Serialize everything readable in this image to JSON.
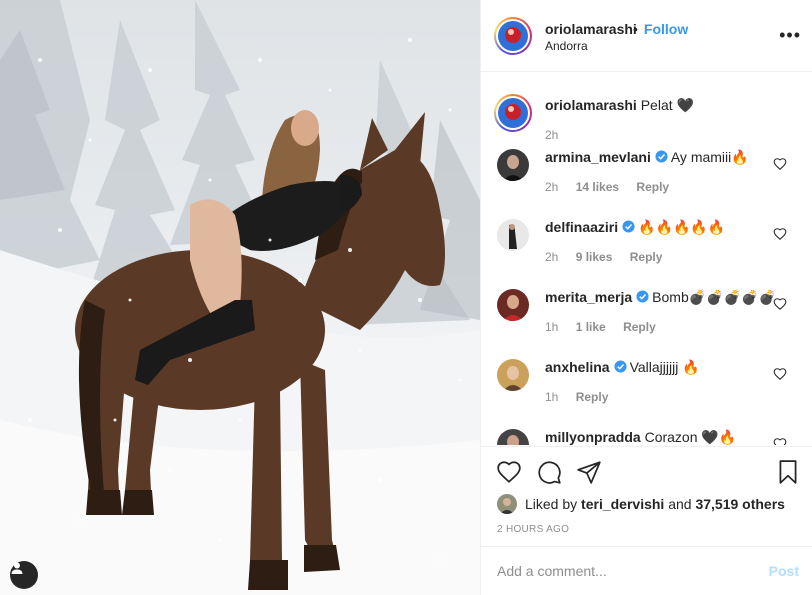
{
  "post": {
    "username": "oriolamarashi",
    "follow_label": "Follow",
    "separator": "•",
    "location": "Andorra",
    "more_label": "•••",
    "caption": {
      "username": "oriolamarashi",
      "text": "Pelat 🖤",
      "time": "2h"
    }
  },
  "comments": [
    {
      "username": "armina_mevlani",
      "verified": true,
      "text": "Ay mamiii🔥",
      "time": "2h",
      "likes": "14 likes",
      "reply": "Reply"
    },
    {
      "username": "delfinaaziri",
      "verified": true,
      "text": "🔥🔥🔥🔥🔥",
      "time": "2h",
      "likes": "9 likes",
      "reply": "Reply"
    },
    {
      "username": "merita_merja",
      "verified": true,
      "text": "Bomb💣💣💣💣💣",
      "time": "1h",
      "likes": "1 like",
      "reply": "Reply"
    },
    {
      "username": "anxhelina",
      "verified": true,
      "text": "Vallajjjjjj 🔥",
      "time": "1h",
      "likes": "",
      "reply": "Reply"
    },
    {
      "username": "millyonpradda",
      "verified": false,
      "text": "Corazon 🖤🔥",
      "time": "",
      "likes": "",
      "reply": ""
    }
  ],
  "likes": {
    "prefix": "Liked by",
    "user": "teri_dervishi",
    "connector": "and",
    "others": "37,519 others"
  },
  "timestamp": "2 HOURS AGO",
  "add_comment": {
    "placeholder": "Add a comment...",
    "post_label": "Post"
  },
  "colors": {
    "accent": "#3897f0",
    "post_disabled": "#b2dffc",
    "verified": "#3897f0",
    "muted": "#8e8e8e",
    "text": "#262626"
  },
  "icons": {
    "like": "heart-icon",
    "comment": "comment-icon",
    "share": "paper-plane-icon",
    "save": "bookmark-icon",
    "user_tag": "user-tag-icon",
    "more": "more-options-icon"
  }
}
